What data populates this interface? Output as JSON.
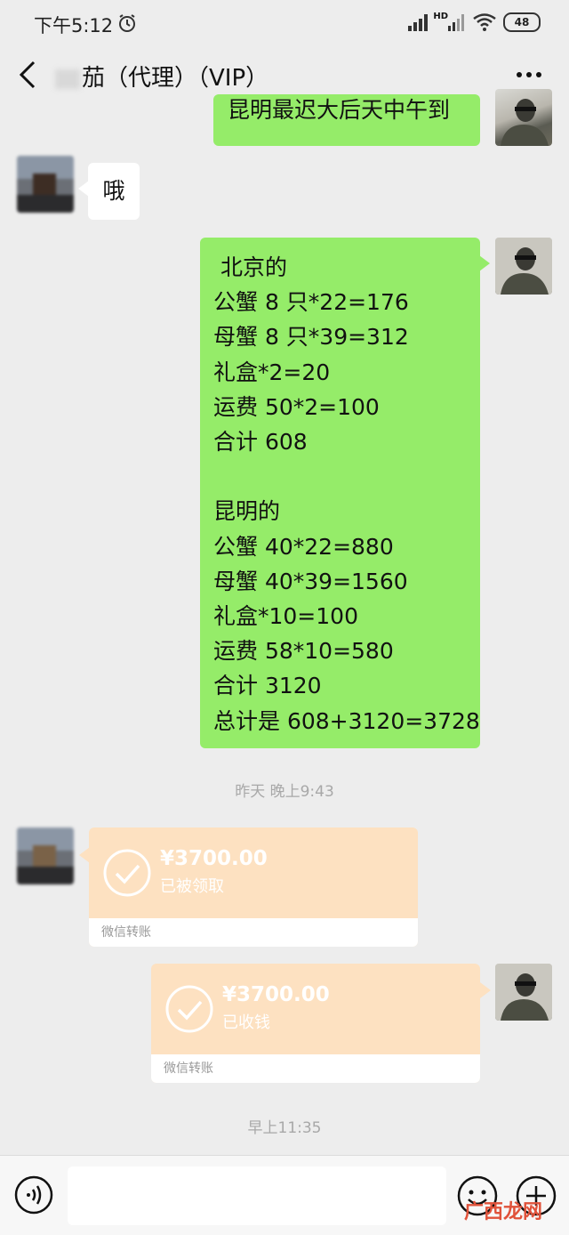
{
  "status_bar": {
    "time": "下午5:12",
    "network": "HD",
    "battery": "48"
  },
  "header": {
    "title": "茄（代理）（VIP）"
  },
  "messages": {
    "m1": {
      "text": "昆明最迟大后天中午到"
    },
    "m2": {
      "text": "哦"
    },
    "m3": {
      "lines": [
        " 北京的",
        "公蟹 8 只*22=176",
        "母蟹 8 只*39=312",
        "礼盒*2=20",
        "运费 50*2=100",
        "合计 608",
        "",
        "昆明的",
        "公蟹 40*22=880",
        "母蟹 40*39=1560",
        "礼盒*10=100",
        "运费 58*10=580",
        "合计 3120",
        "总计是 608+3120=3728"
      ]
    }
  },
  "timestamps": {
    "t1": "昨天 晚上9:43",
    "t2": "早上11:35"
  },
  "transfers": {
    "received": {
      "amount": "¥3700.00",
      "status": "已被领取",
      "footer": "微信转账"
    },
    "sent": {
      "amount": "¥3700.00",
      "status": "已收钱",
      "footer": "微信转账"
    }
  },
  "watermark": "广西龙网",
  "colors": {
    "my_bubble": "#95ec69",
    "transfer": "#fde1c1",
    "background": "#ededed"
  }
}
